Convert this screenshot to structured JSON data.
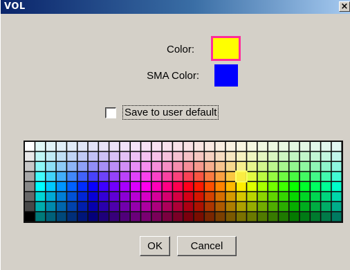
{
  "window": {
    "title": "VOL",
    "close_glyph": "✕"
  },
  "color_label": "Color:",
  "sma_color_label": "SMA Color:",
  "color_value": "#ffff00",
  "color_selected_border": "#ff2d9a",
  "sma_color_value": "#0000ff",
  "save_default": {
    "label": "Save to user default",
    "checked": false
  },
  "palette": {
    "columns": 30,
    "rows": 8,
    "selected_column": 20,
    "selected_row": 3
  },
  "buttons": {
    "ok": "OK",
    "cancel": "Cancel"
  },
  "icons": {
    "close": "close-icon"
  }
}
